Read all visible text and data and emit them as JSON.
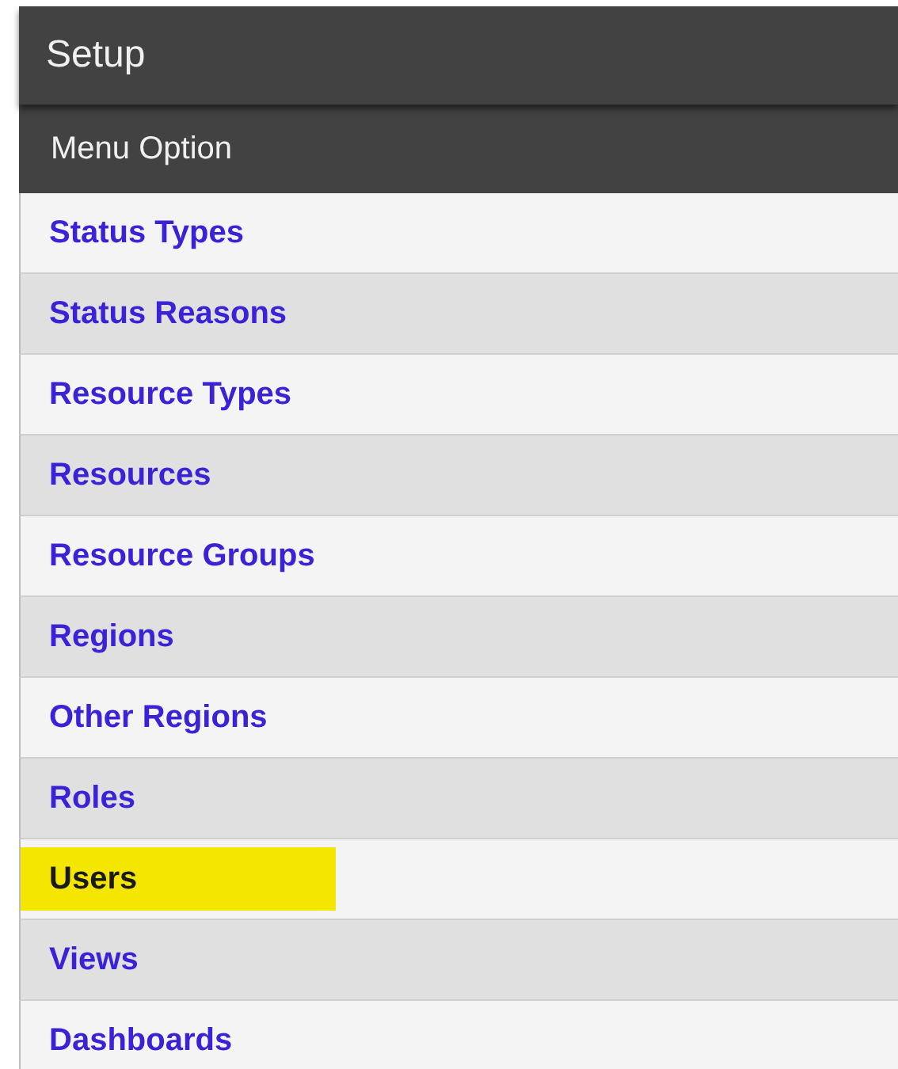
{
  "header": {
    "title": "Setup"
  },
  "table": {
    "column": "Menu Option",
    "items": [
      {
        "label": "Status Types",
        "highlighted": false
      },
      {
        "label": "Status Reasons",
        "highlighted": false
      },
      {
        "label": "Resource Types",
        "highlighted": false
      },
      {
        "label": "Resources",
        "highlighted": false
      },
      {
        "label": "Resource Groups",
        "highlighted": false
      },
      {
        "label": "Regions",
        "highlighted": false
      },
      {
        "label": "Other Regions",
        "highlighted": false
      },
      {
        "label": "Roles",
        "highlighted": false
      },
      {
        "label": "Users",
        "highlighted": true
      },
      {
        "label": "Views",
        "highlighted": false
      },
      {
        "label": "Dashboards",
        "highlighted": false
      }
    ]
  }
}
